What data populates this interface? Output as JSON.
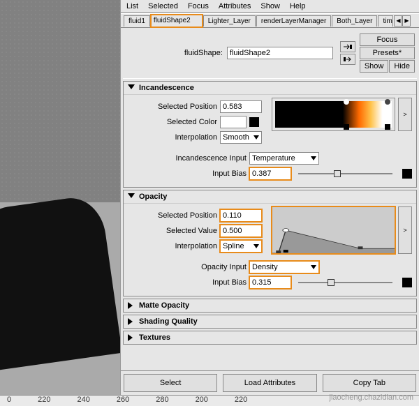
{
  "menubar": [
    "List",
    "Selected",
    "Focus",
    "Attributes",
    "Show",
    "Help"
  ],
  "tabs": {
    "items": [
      "fluid1",
      "fluidShape2",
      "Lighter_Layer",
      "renderLayerManager",
      "Both_Layer",
      "time"
    ],
    "selected_index": 1,
    "highlighted_index": 1
  },
  "header": {
    "label": "fluidShape:",
    "value": "fluidShape2",
    "buttons": {
      "focus": "Focus",
      "presets": "Presets*",
      "show": "Show",
      "hide": "Hide"
    }
  },
  "incandescence": {
    "title": "Incandescence",
    "selected_position": {
      "label": "Selected Position",
      "value": "0.583"
    },
    "selected_color": {
      "label": "Selected Color",
      "hex": "#ffffff"
    },
    "interpolation": {
      "label": "Interpolation",
      "value": "Smooth"
    },
    "input": {
      "label": "Incandescence Input",
      "value": "Temperature"
    },
    "input_bias": {
      "label": "Input Bias",
      "value": "0.387",
      "highlight": true
    },
    "ramp": {
      "stops": [
        {
          "pos": 0.0,
          "color": "#000000"
        },
        {
          "pos": 0.58,
          "color": "#000000"
        },
        {
          "pos": 0.92,
          "color": "#ffffff"
        }
      ],
      "selected_stop": 1
    }
  },
  "opacity": {
    "title": "Opacity",
    "selected_position": {
      "label": "Selected Position",
      "value": "0.110",
      "highlight": true
    },
    "selected_value": {
      "label": "Selected Value",
      "value": "0.500",
      "highlight": true
    },
    "interpolation": {
      "label": "Interpolation",
      "value": "Spline",
      "highlight": true
    },
    "input": {
      "label": "Opacity Input",
      "value": "Density",
      "highlight": true
    },
    "input_bias": {
      "label": "Input Bias",
      "value": "0.315",
      "highlight": true
    },
    "graph_highlight": true,
    "curve": [
      {
        "x": 0.0,
        "y": 0.0
      },
      {
        "x": 0.05,
        "y": 0.0
      },
      {
        "x": 0.11,
        "y": 0.5
      },
      {
        "x": 0.22,
        "y": 0.42
      },
      {
        "x": 0.72,
        "y": 0.1
      },
      {
        "x": 1.0,
        "y": 0.1
      }
    ]
  },
  "collapsed_sections": [
    "Matte Opacity",
    "Shading Quality",
    "Textures"
  ],
  "bottom_buttons": [
    "Select",
    "Load Attributes",
    "Copy Tab"
  ],
  "ruler_ticks": [
    "0",
    "220",
    "240",
    "260",
    "280",
    "200",
    "220"
  ],
  "watermark": "jiaocheng.chazidian.com"
}
